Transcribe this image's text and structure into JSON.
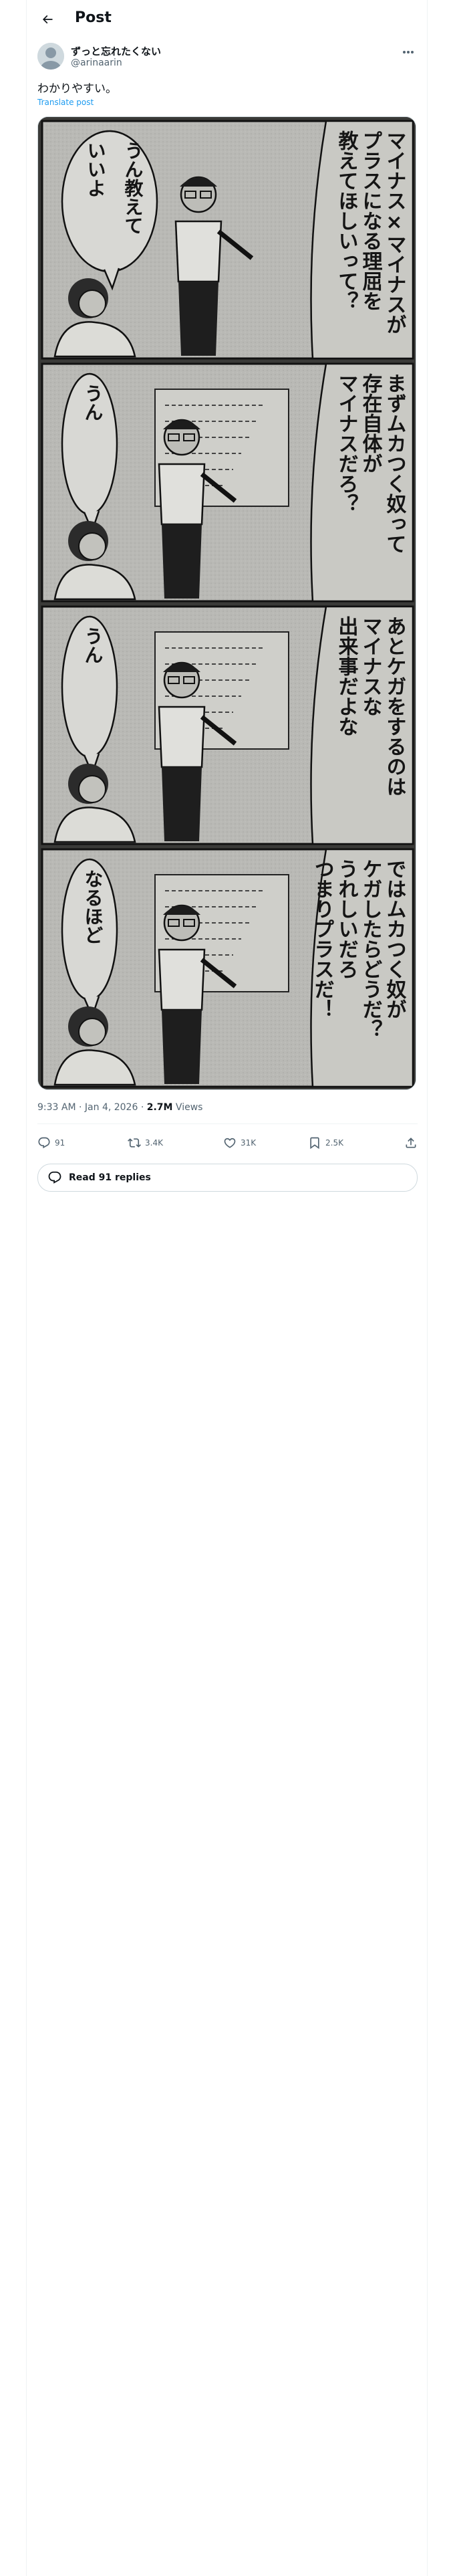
{
  "header": {
    "title": "Post"
  },
  "author": {
    "display_name": "ずっと忘れたくない",
    "handle": "@arinaarin"
  },
  "post": {
    "text": "わかりやすい。",
    "translate_label": "Translate post"
  },
  "media": {
    "panels": [
      {
        "speech": [
          "うん教えて",
          "いいよ"
        ],
        "narration": [
          "マイナス×マイナスが",
          "プラスになる理屈を",
          "教えてほしいって？"
        ]
      },
      {
        "speech": [
          "うん"
        ],
        "narration": [
          "まずムカつく奴って",
          "存在自体が",
          "マイナスだろ？"
        ]
      },
      {
        "speech": [
          "うん"
        ],
        "narration": [
          "あとケガをするのは",
          "マイナスな",
          "出来事だよな"
        ]
      },
      {
        "speech": [
          "なるほど"
        ],
        "narration": [
          "ではムカつく奴が",
          "ケガしたらどうだ？",
          "うれしいだろ",
          "つまりプラスだ！"
        ]
      }
    ]
  },
  "meta": {
    "time": "9:33 AM",
    "date": "Jan 4, 2026",
    "views_count": "2.7M",
    "views_label": "Views"
  },
  "actions": {
    "replies": "91",
    "reposts": "3.4K",
    "likes": "31K",
    "bookmarks": "2.5K"
  },
  "read_replies": {
    "label": "Read 91 replies"
  },
  "icons": {
    "back": "arrow-left-icon",
    "more": "more-dots-icon",
    "reply": "reply-bubble-icon",
    "repost": "repost-icon",
    "like": "heart-icon",
    "bookmark": "bookmark-icon",
    "share": "share-icon"
  }
}
